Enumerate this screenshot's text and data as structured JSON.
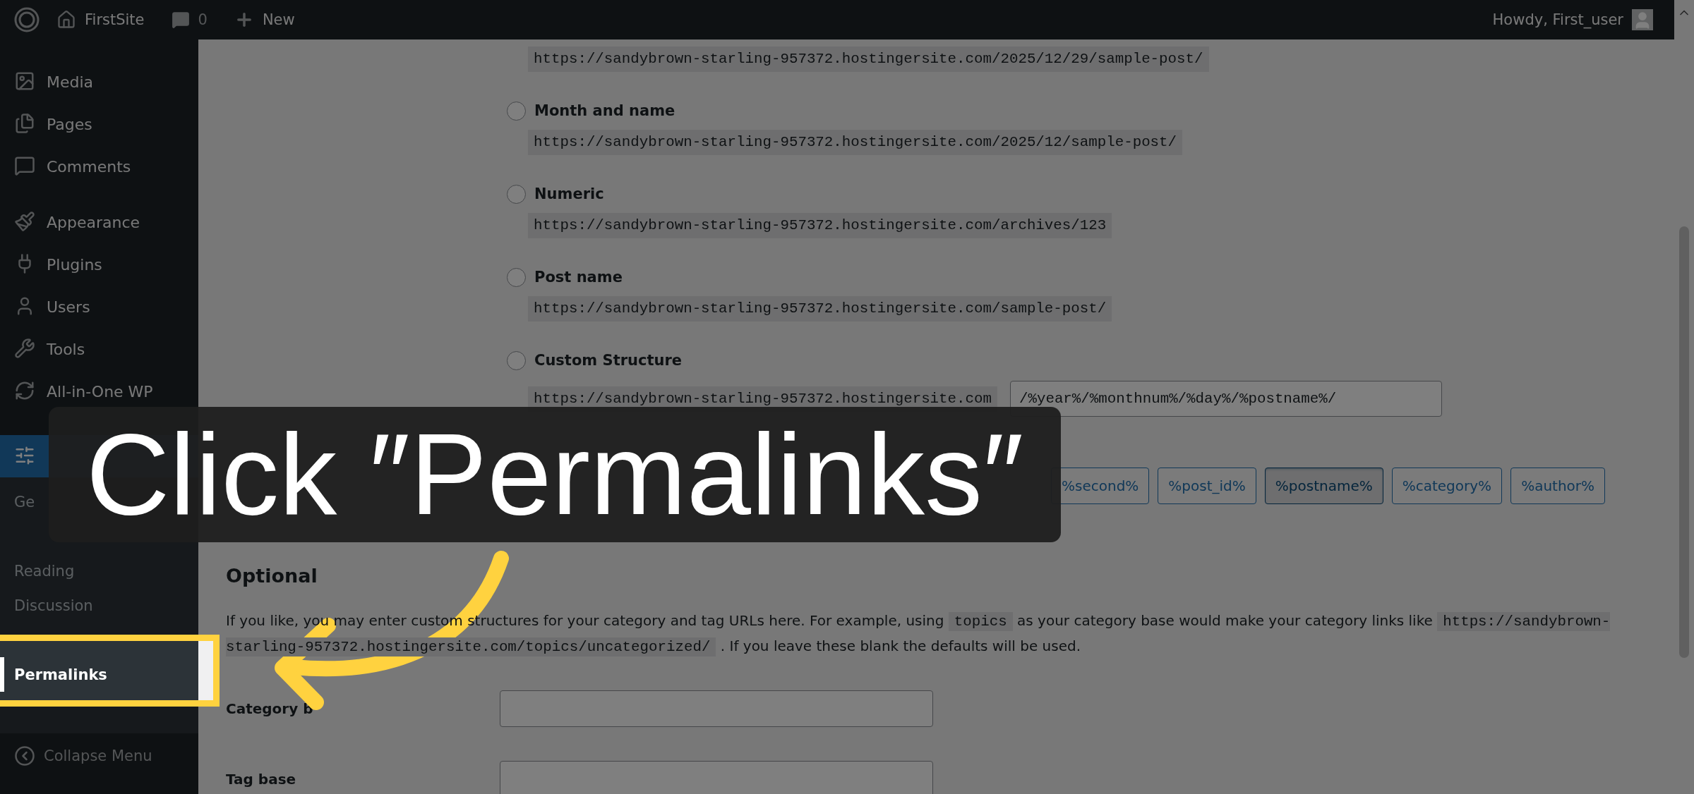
{
  "top_bar": {
    "site": "FirstSite",
    "comments": "0",
    "new": "New",
    "greeting": "Howdy, First_user"
  },
  "sidebar": {
    "items": [
      {
        "label": "Media",
        "selected": false
      },
      {
        "label": "Pages",
        "selected": false
      },
      {
        "label": "Comments",
        "selected": false
      },
      {
        "label": "Appearance",
        "selected": false
      },
      {
        "label": "Plugins",
        "selected": false
      },
      {
        "label": "Users",
        "selected": false
      },
      {
        "label": "Tools",
        "selected": false
      },
      {
        "label": "All-in-One WP",
        "selected": false
      },
      {
        "selected": true,
        "children": [
          {
            "label": "Ge",
            "selected": false
          },
          {
            "label": "Reading",
            "selected": false
          },
          {
            "label": "Discussion",
            "selected": false
          },
          {
            "label": "Permalinks",
            "selected": true
          }
        ]
      }
    ],
    "collapse": "Collapse Menu"
  },
  "permalinks": {
    "partial_url": "https://sandybrown-starling-957372.hostingersite.com/2025/12/29/sample-post/",
    "options": [
      {
        "label": "Month and name",
        "url": "https://sandybrown-starling-957372.hostingersite.com/2025/12/sample-post/",
        "selected": false
      },
      {
        "label": "Numeric",
        "url": "https://sandybrown-starling-957372.hostingersite.com/archives/123",
        "selected": false
      },
      {
        "label": "Post name",
        "url": "https://sandybrown-starling-957372.hostingersite.com/sample-post/",
        "selected": false
      }
    ],
    "custom": {
      "label": "Custom Structure",
      "selected": false,
      "base": "https://sandybrown-starling-957372.hostingersite.com",
      "value": "/%year%/%monthnum%/%day%/%postname%/"
    },
    "tags": [
      {
        "label": "%second%",
        "selected": false
      },
      {
        "label": "%post_id%",
        "selected": false
      },
      {
        "label": "%postname%",
        "selected": true
      },
      {
        "label": "%category%",
        "selected": false
      },
      {
        "label": "%author%",
        "selected": false
      }
    ]
  },
  "optional": {
    "heading": "Optional",
    "description": [
      {
        "kind": "text",
        "text": "If you like, you may enter custom structures for your category and tag URLs here. For example, using "
      },
      {
        "kind": "code",
        "text": "topics"
      },
      {
        "kind": "text",
        "text": " as your category base would make your category links like "
      },
      {
        "kind": "code",
        "text": "https://sandybrown-starling-957372.hostingersite.com/topics/uncategorized/"
      },
      {
        "kind": "text",
        "text": " . If you leave these blank the defaults will be used."
      }
    ],
    "fields": [
      {
        "label": "Category b"
      },
      {
        "label": "Tag base"
      }
    ]
  },
  "callout": {
    "text": "Click ″Permalinks″"
  }
}
